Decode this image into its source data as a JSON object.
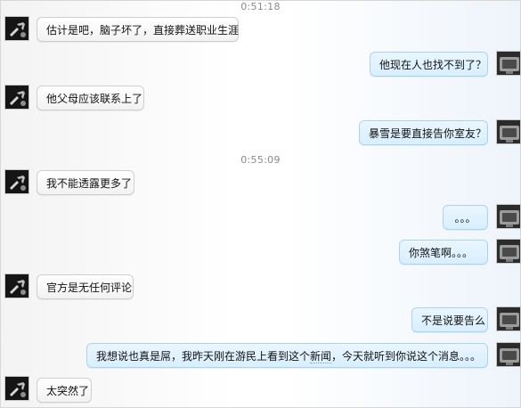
{
  "timestamps": [
    "0:51:18",
    "0:55:09"
  ],
  "messages": [
    {
      "side": "left",
      "text": "估计是吧，脑子坏了，直接葬送职业生涯"
    },
    {
      "side": "right",
      "text": "他现在人也找不到了？"
    },
    {
      "side": "left",
      "text": "他父母应该联系上了"
    },
    {
      "side": "right",
      "text": "暴雪是要直接告你室友？"
    },
    {
      "side": "left",
      "text": "我不能透露更多了"
    },
    {
      "side": "right",
      "text": "。。。"
    },
    {
      "side": "right",
      "text": "你煞笔啊。。。"
    },
    {
      "side": "left",
      "text": "官方是无任何评论"
    },
    {
      "side": "right",
      "text": "不是说要告么"
    },
    {
      "side": "right",
      "text_before": "我想说也真是屌，我昨天刚在游民上看到这个",
      "text_highlight": "新闻",
      "text_after": "，今天就听到你说这个消息。。。"
    },
    {
      "side": "left",
      "text": "太突然了"
    }
  ],
  "icons": {
    "left_avatar": "tool-avatar-icon",
    "right_avatar": "console-avatar-icon"
  }
}
